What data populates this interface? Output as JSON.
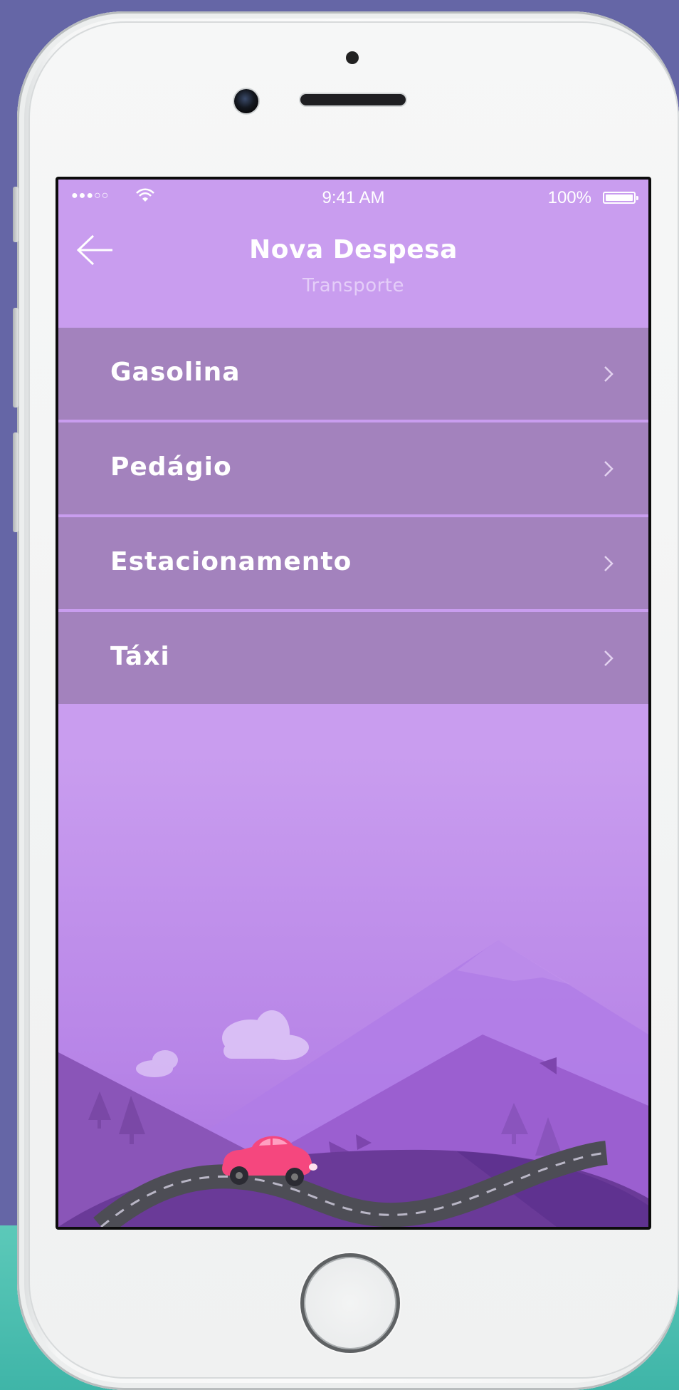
{
  "status_bar": {
    "signal": "●●●○○",
    "time": "9:41 AM",
    "battery": "100%"
  },
  "header": {
    "title": "Nova Despesa",
    "subtitle": "Transporte"
  },
  "menu": {
    "items": [
      {
        "label": "Gasolina"
      },
      {
        "label": "Pedágio"
      },
      {
        "label": "Estacionamento"
      },
      {
        "label": "Táxi"
      }
    ]
  },
  "colors": {
    "page_background": "#6566a6",
    "screen_background": "#c99def",
    "menu_item": "#a382bd",
    "car": "#f5477e",
    "teal_band": "#4cbfb0"
  },
  "icons": {
    "back": "arrow-left-icon",
    "chevron": "chevron-right-icon",
    "wifi": "wifi-icon",
    "battery": "battery-icon"
  }
}
